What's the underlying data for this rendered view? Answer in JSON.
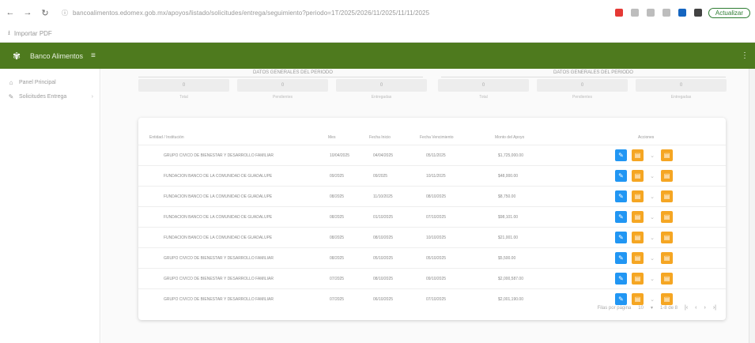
{
  "browser": {
    "url": "bancoalimentos.edomex.gob.mx/apoyos/listado/solicitudes/entrega/seguimiento?periodo=1T/2025/2026/11/2025/11/11/2025",
    "profile_label": "Actualizar",
    "bookmark_label": "Importar PDF"
  },
  "header": {
    "app_title": "Banco Alimentos",
    "menu_icon": "≡"
  },
  "sidebar": {
    "items": [
      {
        "label": "Panel Principal",
        "icon": "home-icon"
      },
      {
        "label": "Solicitudes Entrega",
        "icon": "edit-icon"
      }
    ]
  },
  "summary": {
    "left_header": "DATOS GENERALES DEL PERIODO",
    "right_header": "DATOS GENERALES DEL PERIODO",
    "boxes": [
      {
        "value": "0",
        "label": "Total"
      },
      {
        "value": "0",
        "label": "Pendientes"
      },
      {
        "value": "0",
        "label": "Entregadas"
      },
      {
        "value": "0",
        "label": "Total"
      },
      {
        "value": "0",
        "label": "Pendientes"
      },
      {
        "value": "0",
        "label": "Entregadas"
      }
    ]
  },
  "table": {
    "headers": {
      "entidad": "Entidad / Institución",
      "mes": "Mes",
      "fecha": "Fecha Inicio",
      "fecha_fin": "Fecha Vencimiento",
      "monto": "Monto del Apoyo",
      "acciones": "Acciones"
    },
    "rows": [
      {
        "entidad": "GRUPO CIVICO DE BIENESTAR Y DESARROLLO FAMILIAR",
        "mes": "10/04/2025",
        "fecha": "04/04/2025",
        "fecha_fin": "05/11/2025",
        "monto": "$1,725,000.00"
      },
      {
        "entidad": "FUNDACION BANCO DE LA COMUNIDAD DE GUADALUPE",
        "mes": "09/2025",
        "fecha": "09/2025",
        "fecha_fin": "10/11/2025",
        "monto": "$48,000.00"
      },
      {
        "entidad": "FUNDACION BANCO DE LA COMUNIDAD DE GUADALUPE",
        "mes": "08/2025",
        "fecha": "11/10/2025",
        "fecha_fin": "08/10/2025",
        "monto": "$8,750.00"
      },
      {
        "entidad": "FUNDACION BANCO DE LA COMUNIDAD DE GUADALUPE",
        "mes": "08/2025",
        "fecha": "01/10/2025",
        "fecha_fin": "07/10/2025",
        "monto": "$98,101.00"
      },
      {
        "entidad": "FUNDACION BANCO DE LA COMUNIDAD DE GUADALUPE",
        "mes": "08/2025",
        "fecha": "08/10/2025",
        "fecha_fin": "10/10/2025",
        "monto": "$21,001.00"
      },
      {
        "entidad": "GRUPO CIVICO DE BIENESTAR Y DESARROLLO FAMILIAR",
        "mes": "08/2025",
        "fecha": "05/10/2025",
        "fecha_fin": "05/10/2025",
        "monto": "$5,500.00"
      },
      {
        "entidad": "GRUPO CIVICO DE BIENESTAR Y DESARROLLO FAMILIAR",
        "mes": "07/2025",
        "fecha": "08/10/2025",
        "fecha_fin": "09/10/2025",
        "monto": "$2,000,587.00"
      },
      {
        "entidad": "GRUPO CIVICO DE BIENESTAR Y DESARROLLO FAMILIAR",
        "mes": "07/2025",
        "fecha": "06/10/2025",
        "fecha_fin": "07/10/2025",
        "monto": "$2,001,190.00"
      }
    ]
  },
  "pagination": {
    "rows_label": "Filas por página",
    "rows_value": "10",
    "range": "1-8 de 8"
  },
  "colors": {
    "header_green": "#4e7a1e",
    "action_blue": "#2196f3",
    "action_orange": "#f5a623"
  }
}
